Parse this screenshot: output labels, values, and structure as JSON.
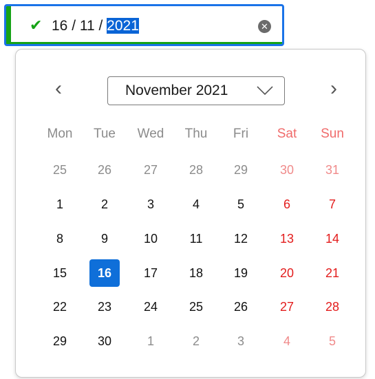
{
  "date_field": {
    "value_prefix": "16 / 11 / ",
    "value_selected": "2021",
    "status_icon": "check-icon",
    "clear_icon": "clear-circle-icon",
    "colors": {
      "focus_border": "#1a73e8",
      "valid": "#16a316"
    }
  },
  "calendar": {
    "month_label": "November 2021",
    "prev_icon": "chevron-left-icon",
    "next_icon": "chevron-right-icon",
    "weekdays": [
      "Mon",
      "Tue",
      "Wed",
      "Thu",
      "Fri",
      "Sat",
      "Sun"
    ],
    "weeks": [
      [
        "25",
        "26",
        "27",
        "28",
        "29",
        "30",
        "31"
      ],
      [
        "1",
        "2",
        "3",
        "4",
        "5",
        "6",
        "7"
      ],
      [
        "8",
        "9",
        "10",
        "11",
        "12",
        "13",
        "14"
      ],
      [
        "15",
        "16",
        "17",
        "18",
        "19",
        "20",
        "21"
      ],
      [
        "22",
        "23",
        "24",
        "25",
        "26",
        "27",
        "28"
      ],
      [
        "29",
        "30",
        "1",
        "2",
        "3",
        "4",
        "5"
      ]
    ],
    "selected_day": "16",
    "colors": {
      "selected": "#0f6fd9",
      "weekend": "#e31c1c",
      "muted": "#8c8c8c"
    }
  }
}
